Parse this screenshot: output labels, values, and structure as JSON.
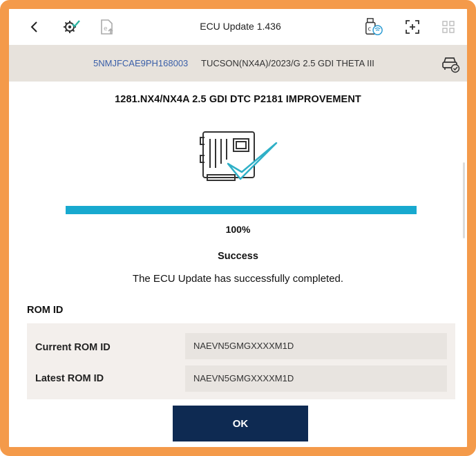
{
  "header": {
    "title": "ECU Update 1.436",
    "icons": [
      "back-chevron-icon",
      "gear-check-icon",
      "document-upload-icon",
      "usb-wifi-icon",
      "expand-icon",
      "grid-icon"
    ]
  },
  "vehicle": {
    "vin": "5NMJFCAE9PH168003",
    "model": "TUCSON(NX4A)/2023/G 2.5 GDI THETA III",
    "icon": "vehicle-check-icon"
  },
  "update": {
    "headline": "1281.NX4/NX4A 2.5 GDI DTC P2181 IMPROVEMENT",
    "progress_percent": 100,
    "progress_label": "100%",
    "status": "Success",
    "message": "The ECU Update has successfully completed."
  },
  "rom": {
    "heading": "ROM ID",
    "rows": [
      {
        "label": "Current ROM ID",
        "value": "NAEVN5GMGXXXXM1D"
      },
      {
        "label": "Latest ROM ID",
        "value": "NAEVN5GMGXXXXM1D"
      }
    ]
  },
  "actions": {
    "ok_label": "OK"
  },
  "colors": {
    "frame": "#f49a4a",
    "progress": "#18a9cf",
    "button": "#0e2a52",
    "vin_link": "#3a5fa8",
    "vehicle_bar": "#e7e2dc"
  }
}
